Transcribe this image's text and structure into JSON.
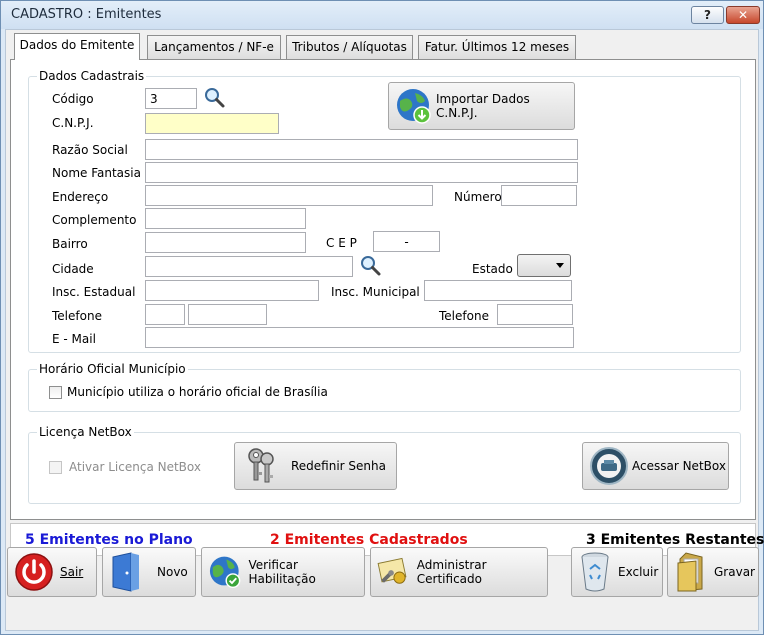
{
  "window": {
    "title": "CADASTRO : Emitentes",
    "help_label": "?",
    "close_label": "✕"
  },
  "tabs": [
    {
      "label": "Dados do Emitente"
    },
    {
      "label": "Lançamentos / NF-e"
    },
    {
      "label": "Tributos / Alíquotas"
    },
    {
      "label": "Fatur. Últimos 12 meses"
    }
  ],
  "dados_cadastrais": {
    "title": "Dados Cadastrais",
    "codigo_label": "Código",
    "codigo_value": "3",
    "cnpj_label": "C.N.P.J.",
    "cnpj_value": "",
    "razao_label": "Razão Social",
    "razao_value": "",
    "fantasia_label": "Nome Fantasia",
    "fantasia_value": "",
    "endereco_label": "Endereço",
    "endereco_value": "",
    "numero_label": "Número",
    "numero_value": "",
    "complemento_label": "Complemento",
    "complemento_value": "",
    "bairro_label": "Bairro",
    "bairro_value": "",
    "cep_label": "C E P",
    "cep_value": "-",
    "cidade_label": "Cidade",
    "cidade_value": "",
    "estado_label": "Estado",
    "estado_value": "",
    "insc_est_label": "Insc. Estadual",
    "insc_est_value": "",
    "insc_mun_label": "Insc. Municipal",
    "insc_mun_value": "",
    "telefone1_label": "Telefone",
    "telefone1_ddd": "",
    "telefone1_value": "",
    "telefone2_label": "Telefone",
    "telefone2_value": "",
    "email_label": "E - Mail",
    "email_value": "",
    "import_button": "Importar Dados C.N.P.J."
  },
  "horario": {
    "title": "Horário Oficial Município",
    "checkbox_label": "Município utiliza o horário oficial de Brasília",
    "checked": false
  },
  "licenca": {
    "title": "Licença NetBox",
    "checkbox_label": "Ativar Licença NetBox",
    "checked": false,
    "redefinir_button": "Redefinir Senha",
    "acessar_button": "Acessar NetBox"
  },
  "status": {
    "plano": "5 Emitentes no Plano",
    "cadastrados": "2 Emitentes Cadastrados",
    "restantes": "3 Emitentes Restantes",
    "plano_color": "#1a1ad6",
    "cadastrados_color": "#e01010",
    "restantes_color": "#000000"
  },
  "toolbar": {
    "sair": "Sair",
    "novo": "Novo",
    "verificar": "Verificar Habilitação",
    "administrar": "Administrar Certificado",
    "excluir": "Excluir",
    "gravar": "Gravar"
  },
  "icons": [
    "help-icon",
    "close-icon",
    "magnifier-icon",
    "globe-download-icon",
    "keys-icon",
    "netbox-icon",
    "power-icon",
    "door-icon",
    "globe-check-icon",
    "certificate-icon",
    "recycle-bin-icon",
    "folder-icon"
  ]
}
